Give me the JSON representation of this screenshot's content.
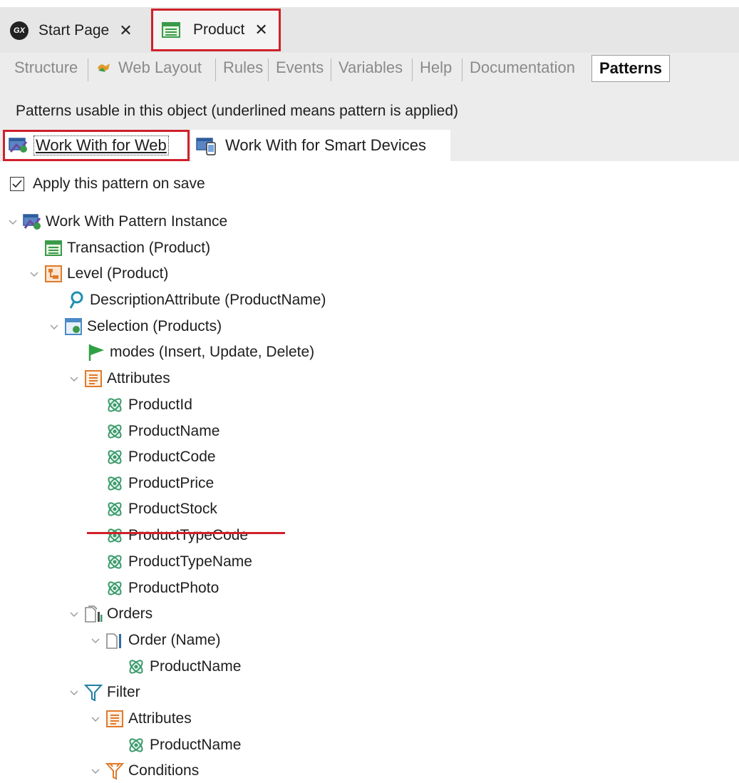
{
  "doc_tabs": {
    "start_icon": "GX",
    "start_label": "Start Page",
    "product_label": "Product"
  },
  "object_tabs": [
    "Structure",
    "Web Layout",
    "Rules",
    "Events",
    "Variables",
    "Help",
    "Documentation",
    "Patterns"
  ],
  "patterns_header": "Patterns usable in this object (underlined means pattern is applied)",
  "pattern_tabs": {
    "web": "Work With for Web",
    "sd": "Work With for Smart Devices"
  },
  "apply_label": "Apply this pattern on save",
  "tree": {
    "root": "Work With Pattern Instance",
    "transaction": "Transaction (Product)",
    "level": "Level (Product)",
    "description_attribute": "DescriptionAttribute (ProductName)",
    "selection": "Selection (Products)",
    "modes": "modes (Insert, Update, Delete)",
    "attributes": "Attributes",
    "attr_items": [
      "ProductId",
      "ProductName",
      "ProductCode",
      "ProductPrice",
      "ProductStock",
      "ProductTypeCode",
      "ProductTypeName",
      "ProductPhoto"
    ],
    "orders": "Orders",
    "order": "Order (Name)",
    "order_attr": "ProductName",
    "filter": "Filter",
    "filter_attributes": "Attributes",
    "filter_attr": "ProductName",
    "conditions": "Conditions"
  },
  "colors": {
    "highlight_red": "#d0202a",
    "attribute_green": "#3a9a6b",
    "level_orange": "#e07a2a",
    "transaction_green": "#3a9a4a"
  }
}
